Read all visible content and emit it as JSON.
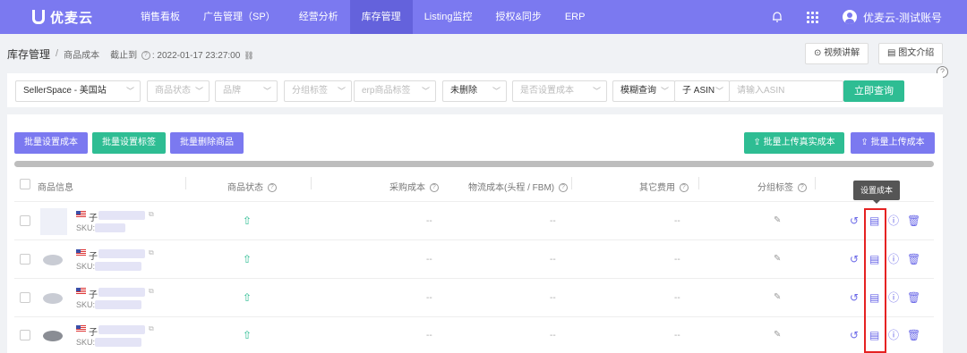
{
  "app": {
    "logo_text": "优麦云"
  },
  "nav": {
    "items": [
      "销售看板",
      "广告管理（SP）",
      "经营分析",
      "库存管理",
      "Listing监控",
      "授权&同步",
      "ERP"
    ],
    "active": "库存管理",
    "user_name": "优麦云-测试账号"
  },
  "breadcrumb": {
    "title": "库存管理",
    "sub": "商品成本",
    "time_label": "截止到",
    "time_value": "2022-01-17 23:27:00"
  },
  "top_buttons": {
    "video": "视频讲解",
    "guide": "图文介绍"
  },
  "filters": {
    "site": "SellerSpace - 美国站",
    "status": "商品状态",
    "brand": "品牌",
    "group_tag": "分组标签",
    "erp_tag": "erp商品标签",
    "deleted": "未删除",
    "cost_set": "是否设置成本",
    "match_mode": "模糊查询",
    "id_type": "子 ASIN",
    "search_placeholder": "请输入ASIN",
    "query_button": "立即查询"
  },
  "actions": {
    "batch_set_cost": "批量设置成本",
    "batch_set_tag": "批量设置标签",
    "batch_delete": "批量删除商品",
    "upload_real_cost": "批量上传真实成本",
    "upload_cost": "批量上传成本"
  },
  "table": {
    "columns": {
      "info": "商品信息",
      "status": "商品状态",
      "purchase_cost": "采购成本",
      "logistics_cost": "物流成本(头程 / FBM)",
      "other_cost": "其它费用",
      "group_tag": "分组标签"
    },
    "rows": [
      {
        "prefix": "子",
        "sku_label": "SKU:",
        "purchase": "--",
        "logistics": "--",
        "other": "--"
      },
      {
        "prefix": "子",
        "sku_label": "SKU:",
        "purchase": "--",
        "logistics": "--",
        "other": "--"
      },
      {
        "prefix": "子",
        "sku_label": "SKU:",
        "purchase": "--",
        "logistics": "--",
        "other": "--"
      },
      {
        "prefix": "子",
        "sku_label": "SKU:",
        "purchase": "--",
        "logistics": "--",
        "other": "--"
      }
    ]
  },
  "tooltip": "设置成本",
  "colors": {
    "primary": "#7b79f0",
    "success": "#2ebd93",
    "highlight": "#e52222"
  }
}
